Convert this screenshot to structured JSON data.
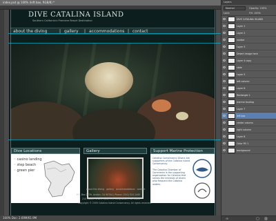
{
  "window": {
    "title": "index.psd @ 100% (left box, RGB/8) *",
    "status": "100%  Doc: 2.69M/61.9M",
    "zoom": "100%"
  },
  "site": {
    "title": "DIVE CATALINA ISLAND",
    "tagline": "Southern California's Premiere Resort Destination",
    "nav": [
      "about the diving",
      "gallery",
      "accommodations",
      "contact"
    ],
    "nav_sep": "|"
  },
  "boxes": {
    "dive": {
      "title": "Dive Locations",
      "items": [
        "casino landing",
        "step beach",
        "green pier"
      ]
    },
    "gallery": {
      "title": "Gallery"
    },
    "support": {
      "title": "Support Marine Protection",
      "p1": "Catalina Conservancy Divers are supporters of the Catalina Island Conservancy.",
      "p2": "The Catalina Chamber of Commerce is the supporting organization for Catalina that serves the interests of divers who frequent the Catalina waters."
    }
  },
  "footer": {
    "links": [
      "about the diving",
      "gallery",
      "accommodations",
      "contact"
    ],
    "line1": "P.O. Box 2739, Avalon, CA 90704 | Phone: (310) 510-1445",
    "line2": "210 Golden Shore, Suite 135, Long Beach, CA 90802",
    "line3": "Copyright © 2009 Catalina Island Conservancy. All rights reserved."
  },
  "panel": {
    "title": "Layers",
    "mode": "Normal",
    "opacity_label": "Opacity: 100%",
    "fill_label": "Fill: 100%",
    "lock_label": "Lock:",
    "layers": [
      {
        "name": "DIVE CATALINA ISLAND",
        "selected": false
      },
      {
        "name": "Layer 1",
        "selected": false
      },
      {
        "name": "Layer 2",
        "selected": false
      },
      {
        "name": "navbar",
        "selected": false
      },
      {
        "name": "Layer 3",
        "selected": false
      },
      {
        "name": "Desert image here",
        "selected": false
      },
      {
        "name": "Layer 4 copy",
        "selected": false
      },
      {
        "name": "slide",
        "selected": false
      },
      {
        "name": "Layer 5",
        "selected": false
      },
      {
        "name": "left column",
        "selected": false
      },
      {
        "name": "Layer 6",
        "selected": false
      },
      {
        "name": "Rectangle 1",
        "selected": false
      },
      {
        "name": "marine landing",
        "selected": false
      },
      {
        "name": "Layer 7",
        "selected": false
      },
      {
        "name": "left box",
        "selected": true
      },
      {
        "name": "center column",
        "selected": false
      },
      {
        "name": "right column",
        "selected": false
      },
      {
        "name": "Layer 8",
        "selected": false
      },
      {
        "name": "Color Fill 1",
        "selected": false
      },
      {
        "name": "background",
        "selected": false
      }
    ]
  },
  "colors": {
    "accent": "#5b7fb0",
    "page_bg": "#0d1e1e",
    "box_head": "#2a4646"
  }
}
